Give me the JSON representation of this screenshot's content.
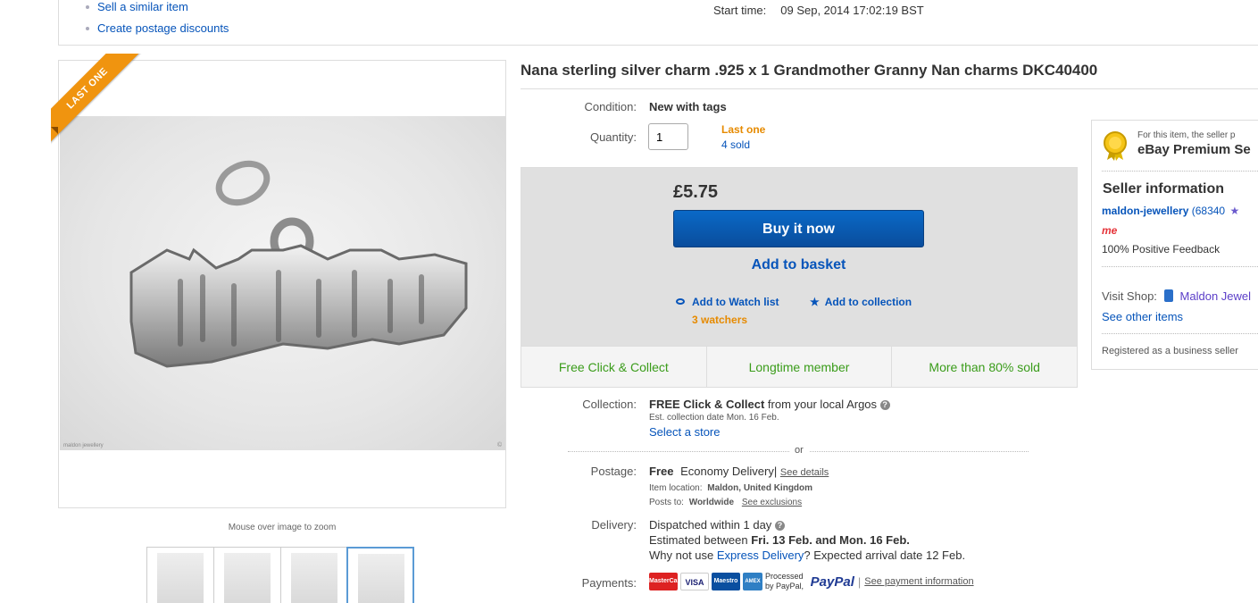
{
  "top": {
    "links": [
      "Sell a similar item",
      "Create postage discounts"
    ],
    "start_time_label": "Start time:",
    "start_time_value": "09 Sep, 2014 17:02:19 BST"
  },
  "gallery": {
    "badge": "LAST ONE",
    "zoom_hint": "Mouse over image to zoom"
  },
  "item": {
    "title": "Nana sterling silver charm .925 x 1 Grandmother Granny Nan charms DKC40400",
    "condition_label": "Condition:",
    "condition_value": "New with tags",
    "quantity_label": "Quantity:",
    "quantity_value": "1",
    "last_one": "Last one",
    "sold": "4 sold"
  },
  "buy": {
    "price": "£5.75",
    "buy_now": "Buy it now",
    "add_to_basket": "Add to basket",
    "watch": "Add to Watch list",
    "collection": "Add to collection",
    "watchers": "3 watchers",
    "features": [
      "Free Click & Collect",
      "Longtime member",
      "More than 80% sold"
    ]
  },
  "collection": {
    "label": "Collection:",
    "free_cc": "FREE Click & Collect",
    "from": " from your local Argos",
    "est": "Est. collection date Mon. 16 Feb.",
    "select_store": "Select a store",
    "or": "or"
  },
  "postage": {
    "label": "Postage:",
    "free": "Free",
    "service": "Economy Delivery",
    "see_details": "See details",
    "location_label": "Item location:",
    "location_value": "Maldon, United Kingdom",
    "posts_label": "Posts to:",
    "posts_value": "Worldwide",
    "see_exclusions": "See exclusions"
  },
  "delivery": {
    "label": "Delivery:",
    "dispatched": "Dispatched within 1 day",
    "estimated_prefix": "Estimated between ",
    "estimated_dates": "Fri. 13 Feb. and Mon. 16 Feb.",
    "why_prefix": "Why not use ",
    "express": "Express Delivery",
    "why_suffix": "? Expected arrival date 12 Feb."
  },
  "payments": {
    "label": "Payments:",
    "cards": [
      "MasterCard",
      "VISA",
      "Maestro",
      "AMEX"
    ],
    "processed": "Processed",
    "by": "by PayPal",
    "paypal": "PayPal",
    "see_info": "See payment information"
  },
  "seller": {
    "premium_note": "For this item, the seller p",
    "premium_title": "eBay Premium Se",
    "info_title": "Seller information",
    "name": "maldon-jewellery",
    "score": "(68340",
    "me_badge": "me",
    "feedback": "100% Positive Feedback",
    "visit_shop_label": "Visit Shop:",
    "shop_name": "Maldon Jewel",
    "see_other": "See other items",
    "registered": "Registered as a business seller"
  },
  "colors": {
    "link": "#0654ba",
    "orange": "#e68a00",
    "green": "#3a9c1a",
    "buy_button": "#0a5bb5"
  }
}
